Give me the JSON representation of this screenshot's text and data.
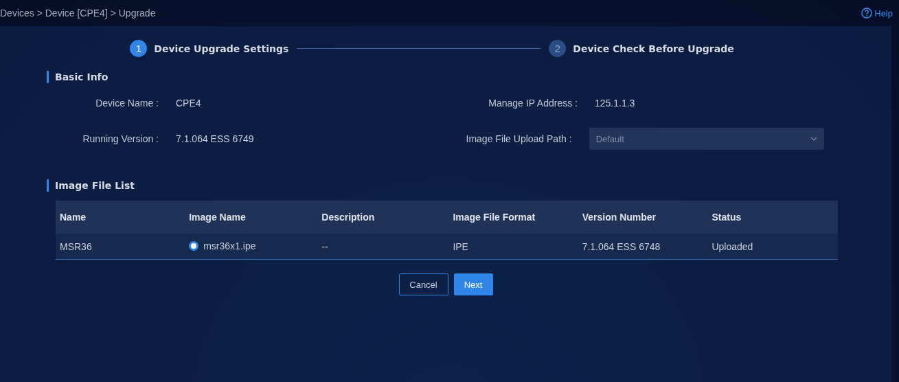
{
  "breadcrumb": "Devices > Device [CPE4] > Upgrade",
  "help": {
    "label": "Help"
  },
  "steps": [
    {
      "number": "1",
      "label": "Device Upgrade Settings",
      "selected": true
    },
    {
      "number": "2",
      "label": "Device Check Before Upgrade",
      "selected": false
    }
  ],
  "basic_info": {
    "title": "Basic Info",
    "fields": [
      {
        "label": "Device Name :",
        "value": "CPE4",
        "kind": "text"
      },
      {
        "label": "Manage IP Address :",
        "value": "125.1.1.3",
        "kind": "text"
      },
      {
        "label": "Running Version :",
        "value": "7.1.064 ESS 6749",
        "kind": "text"
      },
      {
        "label": "Image File Upload Path :",
        "value": "Default",
        "kind": "select"
      }
    ]
  },
  "image_file_list": {
    "title": "Image File List",
    "columns": [
      "Name",
      "Image Name",
      "Description",
      "Image File Format",
      "Version Number",
      "Status"
    ],
    "rows": [
      {
        "name": "MSR36",
        "image_name": "msr36x1.ipe",
        "selected": true,
        "description": "--",
        "format": "IPE",
        "version": "7.1.064 ESS 6748",
        "status": "Uploaded"
      }
    ]
  },
  "buttons": [
    {
      "label": "Cancel",
      "kind": "secondary"
    },
    {
      "label": "Next",
      "kind": "primary"
    }
  ]
}
